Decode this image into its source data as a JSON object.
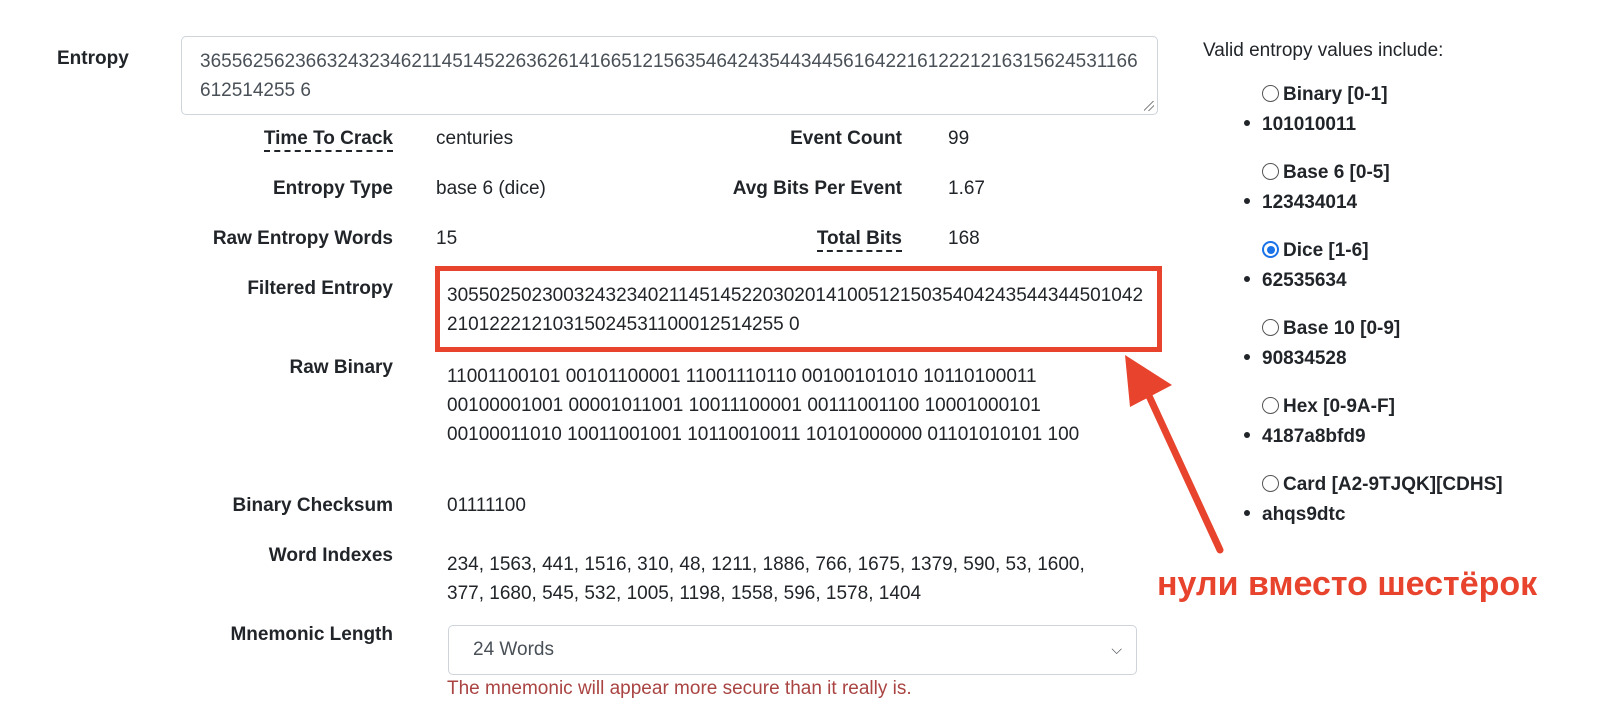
{
  "entropy": {
    "label": "Entropy",
    "value": "36556256236632432346211451452263626141665121563546424354434456164221612221216315624531166612514255 6"
  },
  "fields": {
    "time_to_crack": {
      "label": "Time To Crack",
      "value": "centuries"
    },
    "event_count": {
      "label": "Event Count",
      "value": "99"
    },
    "entropy_type": {
      "label": "Entropy Type",
      "value": "base 6 (dice)"
    },
    "avg_bits": {
      "label": "Avg Bits Per Event",
      "value": "1.67"
    },
    "raw_words": {
      "label": "Raw Entropy Words",
      "value": "15"
    },
    "total_bits": {
      "label": "Total Bits",
      "value": "168"
    },
    "filtered": {
      "label": "Filtered Entropy",
      "value": "30550250230032432340211451452203020141005121503540424354434450104221012221210315024531100012514255 0"
    },
    "raw_binary": {
      "label": "Raw Binary",
      "value": "11001100101 00101100001 11001110110 00100101010 10110100011 00100001001 00001011001 10011100001 00111001100 10001000101 00100011010 10011001001 10110010011 10101000000 01101010101 100"
    },
    "checksum": {
      "label": "Binary Checksum",
      "value": "01111100"
    },
    "word_indexes": {
      "label": "Word Indexes",
      "value": "234, 1563, 441, 1516, 310, 48, 1211, 1886, 766, 1675, 1379, 590, 53, 1600, 377, 1680, 545, 532, 1005, 1198, 1558, 596, 1578, 1404"
    },
    "mnemonic_length": {
      "label": "Mnemonic Length",
      "selected": "24 Words",
      "warning": "The mnemonic will appear more secure than it really is."
    }
  },
  "sidebar": {
    "heading": "Valid entropy values include:",
    "options": [
      {
        "label": "Binary [0-1]",
        "example": "101010011",
        "checked": false
      },
      {
        "label": "Base 6 [0-5]",
        "example": "123434014",
        "checked": false
      },
      {
        "label": "Dice [1-6]",
        "example": "62535634",
        "checked": true
      },
      {
        "label": "Base 10 [0-9]",
        "example": "90834528",
        "checked": false
      },
      {
        "label": "Hex [0-9A-F]",
        "example": "4187a8bfd9",
        "checked": false
      },
      {
        "label": "Card [A2-9TJQK][CDHS]",
        "example": "ahqs9dtc",
        "checked": false
      }
    ]
  },
  "annotation": {
    "text": "нули вместо шестёрок",
    "color": "#e8432d"
  }
}
